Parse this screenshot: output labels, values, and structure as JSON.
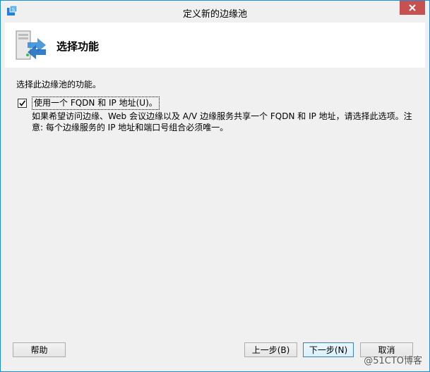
{
  "window": {
    "title": "定义新的边缘池"
  },
  "header": {
    "title": "选择功能"
  },
  "main": {
    "instruction": "选择此边缘池的功能。",
    "checkbox": {
      "label": "使用一个 FQDN 和 IP 地址(U)。",
      "checked": true
    },
    "description": "如果希望访问边缘、Web 会议边缘以及 A/V 边缘服务共享一个 FQDN 和 IP 地址，请选择此选项。注意: 每个边缘服务的 IP 地址和端口号组合必须唯一。"
  },
  "buttons": {
    "help": "帮助",
    "prev": "上一步(B)",
    "next": "下一步(N)",
    "cancel": "取消"
  },
  "watermark": "@51CTO博客",
  "colors": {
    "border": "#1e8fd6",
    "close": "#c75050",
    "header_bg": "#ffffff"
  },
  "icons": [
    "app-icon",
    "close-icon",
    "server-arrows-icon",
    "checkmark-icon"
  ]
}
